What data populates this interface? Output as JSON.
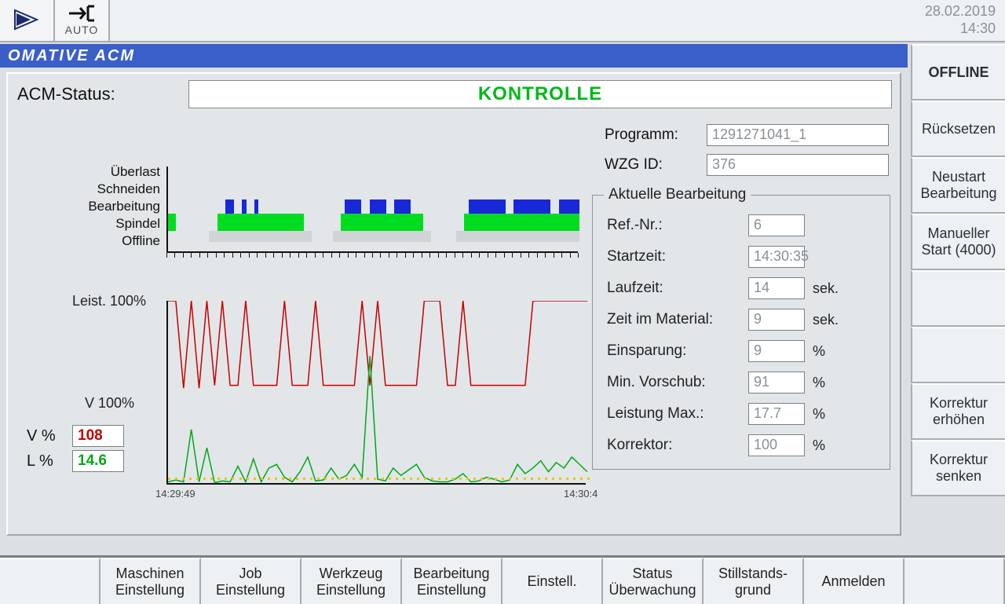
{
  "header": {
    "auto_label": "AUTO",
    "date": "28.02.2019",
    "time": "14:30"
  },
  "title": "OMATIVE ACM",
  "rightbuttons": [
    "OFFLINE",
    "Rücksetzen",
    "Neustart Bearbeitung",
    "Manueller Start (4000)",
    "",
    "",
    "Korrektur erhöhen",
    "Korrektur senken"
  ],
  "status": {
    "label": "ACM-Status:",
    "value": "KONTROLLE"
  },
  "programm": {
    "label": "Programm:",
    "value": "1291271041_1"
  },
  "wzgid": {
    "label": "WZG ID:",
    "value": "376"
  },
  "aktuelle": {
    "legend": "Aktuelle Bearbeitung",
    "rows": [
      {
        "label": "Ref.-Nr.:",
        "value": "6",
        "unit": ""
      },
      {
        "label": "Startzeit:",
        "value": "14:30:35",
        "unit": ""
      },
      {
        "label": "Laufzeit:",
        "value": "14",
        "unit": "sek."
      },
      {
        "label": "Zeit im Material:",
        "value": "9",
        "unit": "sek."
      },
      {
        "label": "Einsparung:",
        "value": "9",
        "unit": "%"
      },
      {
        "label": "Min. Vorschub:",
        "value": "91",
        "unit": "%"
      },
      {
        "label": "Leistung Max.:",
        "value": "17.7",
        "unit": "%"
      },
      {
        "label": "Korrektor:",
        "value": "100",
        "unit": "%"
      }
    ]
  },
  "timeline_labels": [
    "Überlast",
    "Schneiden",
    "Bearbeitung",
    "Spindel",
    "Offline"
  ],
  "linechart": {
    "label_leist": "Leist. 100%",
    "label_v100": "V 100%",
    "v_label": "V %",
    "v_value": "108",
    "l_label": "L %",
    "l_value": "14.6",
    "x_left": "14:29:49",
    "x_right": "14:30:4"
  },
  "bottombuttons": [
    "",
    "Maschinen Einstellung",
    "Job Einstellung",
    "Werkzeug Einstellung",
    "Bearbeitung Einstellung",
    "Einstell.",
    "Status Überwachung",
    "Stillstands-grund",
    "Anmelden",
    ""
  ],
  "chart_data": {
    "timeline": {
      "type": "bar",
      "tracks": [
        "Überlast",
        "Schneiden",
        "Bearbeitung",
        "Spindel",
        "Offline"
      ],
      "bearbeitung_segments_pct": [
        [
          0,
          2
        ],
        [
          12,
          33
        ],
        [
          42,
          62
        ],
        [
          72,
          100
        ]
      ],
      "spindel_segments_pct": [
        [
          10,
          35
        ],
        [
          40,
          64
        ],
        [
          70,
          100
        ]
      ],
      "schneiden_segments_pct": [
        [
          14,
          16
        ],
        [
          18,
          19
        ],
        [
          21,
          22
        ],
        [
          43,
          47
        ],
        [
          49,
          53
        ],
        [
          55,
          59
        ],
        [
          73,
          82
        ],
        [
          84,
          93
        ],
        [
          95,
          100
        ]
      ],
      "x_range": [
        "14:29:49",
        "14:30:4"
      ]
    },
    "linechart": {
      "type": "line",
      "x_range_sec": [
        0,
        55
      ],
      "xlabel_left": "14:29:49",
      "xlabel_right": "14:30:4",
      "series": [
        {
          "name": "V % (Korrektor)",
          "color": "#c80000",
          "y_ref_line": 100,
          "values_pct": [
            200,
            200,
            105,
            200,
            105,
            200,
            108,
            200,
            108,
            108,
            200,
            108,
            108,
            108,
            108,
            200,
            108,
            108,
            108,
            200,
            108,
            108,
            108,
            108,
            108,
            200,
            108,
            200,
            108,
            108,
            108,
            108,
            108,
            200,
            200,
            200,
            108,
            108,
            200,
            108,
            108,
            108,
            108,
            108,
            108,
            108,
            108,
            200,
            200,
            200,
            200,
            200,
            200,
            200,
            200
          ]
        },
        {
          "name": "L % (Leistung)",
          "color": "#00a818",
          "y_ref_line": 100,
          "values_pct": [
            3,
            5,
            3,
            60,
            3,
            40,
            2,
            4,
            3,
            20,
            3,
            28,
            3,
            18,
            22,
            8,
            3,
            14,
            30,
            4,
            5,
            18,
            6,
            10,
            22,
            8,
            140,
            6,
            4,
            18,
            10,
            16,
            22,
            8,
            4,
            3,
            3,
            6,
            12,
            3,
            4,
            8,
            6,
            3,
            5,
            22,
            12,
            18,
            26,
            14,
            24,
            18,
            30,
            22,
            14
          ]
        }
      ]
    }
  }
}
